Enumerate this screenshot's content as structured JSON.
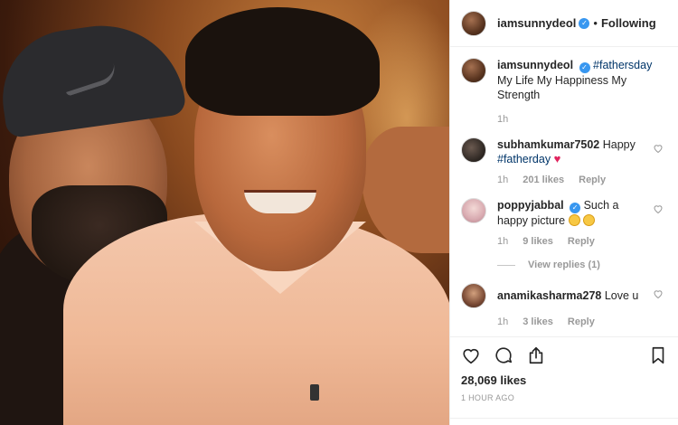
{
  "post": {
    "author": "iamsunnydeol",
    "follow_status": "Following",
    "separator": "•",
    "caption_hashtag": "#fathersday",
    "caption_text": "My Life My Happiness My Strength",
    "caption_time": "1h"
  },
  "comments": [
    {
      "user": "subhamkumar7502",
      "text": "Happy",
      "hashtag": "#fatherday",
      "time": "1h",
      "likes": "201 likes",
      "reply": "Reply"
    },
    {
      "user": "poppyjabbal",
      "text": "Such a happy picture",
      "time": "1h",
      "likes": "9 likes",
      "reply": "Reply",
      "view_replies": "View replies (1)"
    },
    {
      "user": "anamikasharma278",
      "text": "Love u",
      "time": "1h",
      "likes": "3 likes",
      "reply": "Reply"
    }
  ],
  "actions": {
    "likes_count": "28,069 likes",
    "timestamp": "1 HOUR AGO"
  },
  "icons": {
    "verified": "verified-badge-icon",
    "like": "heart-icon",
    "comment": "comment-bubble-icon",
    "share": "share-icon",
    "save": "bookmark-icon"
  },
  "colors": {
    "verified_blue": "#3897f0",
    "hashtag": "#003569",
    "muted": "#999999",
    "heart_red": "#e0245e"
  }
}
